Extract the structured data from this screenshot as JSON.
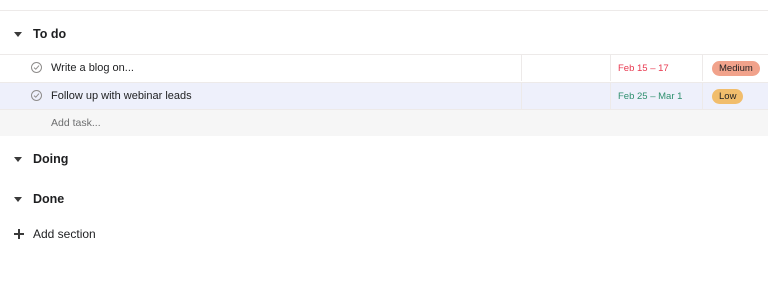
{
  "sections": {
    "todo": {
      "title": "To do"
    },
    "doing": {
      "title": "Doing"
    },
    "done": {
      "title": "Done"
    }
  },
  "tasks": [
    {
      "name": "Write a blog on...",
      "due": "Feb 15 – 17",
      "due_color": "#e8384f",
      "priority": "Medium",
      "priority_color": "#f1a28b"
    },
    {
      "name": "Follow up with webinar leads",
      "due": "Feb 25 – Mar 1",
      "due_color": "#2e8f6e",
      "priority": "Low",
      "priority_color": "#f1bd6c"
    }
  ],
  "add_task": {
    "label": "Add task..."
  },
  "add_section": {
    "label": "Add section"
  },
  "icons": {
    "caret": "caret-down-icon",
    "check": "check-circle-icon",
    "plus": "plus-icon"
  }
}
